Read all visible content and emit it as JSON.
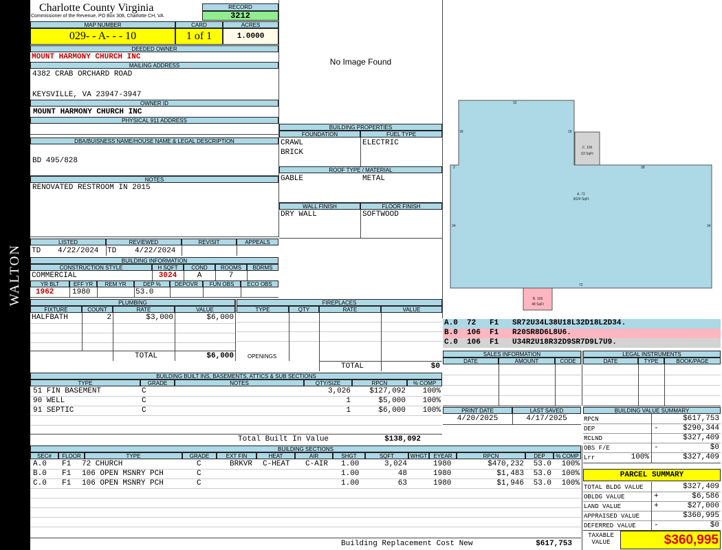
{
  "sidebar": {
    "owner_name": "WALTON"
  },
  "header": {
    "county": "Charlotte County Virginia",
    "commissioner": "Commissioner of the Revenue, PO Box 308, Charlotte CH, VA",
    "record_label": "RECORD",
    "record": "3212",
    "map_number_label": "MAP NUMBER",
    "map_number": "029- - A- - - 10",
    "card_label": "CARD",
    "card": "1 of 1",
    "acres_label": "ACRES",
    "acres": "1.0000"
  },
  "owner": {
    "deeded_owner_label": "DEEDED OWNER",
    "deeded_owner": "MOUNT HARMONY CHURCH INC",
    "mailing_label": "MAILING ADDRESS",
    "address_line1": "4382 CRAB ORCHARD ROAD",
    "address_line2": "KEYSVILLE, VA 23947-3947",
    "owner_id_label": "OWNER ID",
    "owner_id": "MOUNT HARMONY CHURCH INC",
    "physical_label": "PHYSICAL 911 ADDRESS",
    "physical": "",
    "dba_label": "DBA/BUISNESS NAME/HOUSE NAME & LEGAL DESCRIPTION",
    "dba": "BD 495/828",
    "notes_label": "NOTES",
    "notes": "RENOVATED RESTROOM IN 2015"
  },
  "image": {
    "placeholder": "No Image Found"
  },
  "building_properties": {
    "title": "BUILDING PROPERTIES",
    "foundation_label": "FOUNDATION",
    "foundation1": "CRAWL",
    "foundation2": "BRICK",
    "fuel_label": "FUEL TYPE",
    "fuel": "ELECTRIC",
    "roof_label": "ROOF TYPE / MATERIAL",
    "roof_type": "GABLE",
    "roof_material": "METAL",
    "wall_label": "WALL FINISH",
    "wall": "DRY WALL",
    "floor_label": "FLOOR FINISH",
    "floor": "SOFTWOOD"
  },
  "status": {
    "listed_label": "LISTED",
    "listed_by": "TD",
    "listed_date": "4/22/2024",
    "reviewed_label": "REVIEWED",
    "reviewed_by": "TD",
    "reviewed_date": "4/22/2024",
    "revisit_label": "REVISIT",
    "appeals_label": "APPEALS"
  },
  "building_info": {
    "title": "BUILDING INFORMATION",
    "style_label": "CONSTRUCTION STYLE",
    "style": "COMMERCIAL",
    "hsqft_label": "H SQFT",
    "hsqft": "3024",
    "cond_label": "COND",
    "cond": "A",
    "rooms_label": "ROOMS",
    "rooms": "7",
    "bdrms_label": "BDRMS",
    "bdrms": "",
    "yrblt_label": "YR BLT",
    "yrblt": "1962",
    "effyr_label": "EFF YR",
    "effyr": "1980",
    "remyr_label": "REM YR",
    "remyr": "",
    "dep_label": "DEP %",
    "dep": "53.0",
    "depovr_label": "DEPOVR",
    "funobs_label": "FUN OBS",
    "ecoobs_label": "ECO OBS"
  },
  "plumbing": {
    "title": "PLUMBING",
    "headers": [
      "FIXTURE",
      "COUNT",
      "RATE",
      "VALUE"
    ],
    "rows": [
      [
        "HALFBATH",
        "2",
        "$3,000",
        "$6,000"
      ]
    ],
    "total_label": "TOTAL",
    "total": "$6,000"
  },
  "fireplaces": {
    "title": "FIREPLACES",
    "headers": [
      "TYPE",
      "QTY",
      "RATE",
      "VALUE"
    ],
    "openings_label": "OPENINGS",
    "total_label": "TOTAL",
    "total": "$0"
  },
  "builtins": {
    "title": "BUILDING BUILT INS, BASEMENTS, ATTICS & SUB SECTIONS",
    "headers": [
      "TYPE",
      "GRADE",
      "NOTES",
      "QTY/SIZE",
      "RPCN",
      "% COMP"
    ],
    "rows": [
      [
        "51 FIN BASEMENT",
        "C",
        "",
        "3,026",
        "$127,092",
        "100%"
      ],
      [
        "90 WELL",
        "C",
        "",
        "1",
        "$5,000",
        "100%"
      ],
      [
        "91 SEPTIC",
        "C",
        "",
        "1",
        "$6,000",
        "100%"
      ]
    ],
    "total_label": "Total Built In Value",
    "total": "$138,092"
  },
  "sections": {
    "title": "BUILDING SECTIONS",
    "headers": [
      "SEC#",
      "FLOOR",
      "TYPE",
      "GRADE",
      "EXT FIN",
      "HEAT",
      "AIR",
      "SHGT",
      "SQFT",
      "WHGT",
      "EYEAR",
      "RPCN",
      "DEP",
      "% COMP"
    ],
    "rows": [
      [
        "A.0",
        "F1",
        "72 CHURCH",
        "C",
        "BRKVR",
        "C-HEAT",
        "C-AIR",
        "1.00",
        "3,024",
        "",
        "1980",
        "$470,232",
        "53.0",
        "100%"
      ],
      [
        "B.0",
        "F1",
        "106 OPEN MSNRY PCH",
        "C",
        "",
        "",
        "",
        "1.00",
        "48",
        "",
        "1980",
        "$1,483",
        "53.0",
        "100%"
      ],
      [
        "C.0",
        "F1",
        "106 OPEN MSNRY PCH",
        "C",
        "",
        "",
        "",
        "1.00",
        "63",
        "",
        "1980",
        "$1,946",
        "53.0",
        "100%"
      ]
    ],
    "total_label": "Building Replacement Cost New",
    "total": "$617,753"
  },
  "sketch": {
    "dims_a_top": "32",
    "dims_a_left_top": "18",
    "dims_a_inner": "18",
    "dims_step": "2",
    "dims_right_top": "38",
    "dims_left": "34",
    "dims_right": "34",
    "dims_bottom": "72",
    "label_a_name": "A. 72",
    "label_a_area": "3024 SqFt",
    "label_b_name": "B. 106",
    "label_b_area": "48 SqFt",
    "label_c_name": "C. 106",
    "label_c_area": "63 SqFt",
    "colors": {
      "a": "#add8e6",
      "b": "#ffb6c1",
      "c": "#d3d3d3"
    }
  },
  "legend": [
    {
      "text": "A.0  72   F1   SR72U34L38U18L32D18L2D34.",
      "color": "#add8e6"
    },
    {
      "text": "B.0  106  F1   R20SR8D6L8U6.",
      "color": "#ffb6c1"
    },
    {
      "text": "C.0  106  F1   U34R2U18R32D9SR7D9L7U9.",
      "color": "#d3d3d3"
    }
  ],
  "sales": {
    "title": "SALES INFORMATION",
    "headers": [
      "DATE",
      "AMOUNT",
      "CODE"
    ]
  },
  "legal": {
    "title": "LEGAL INSTRUMENTS",
    "headers": [
      "DATE",
      "TYPE",
      "BOOK/PAGE"
    ]
  },
  "dates": {
    "print_label": "PRINT DATE",
    "print": "4/20/2025",
    "saved_label": "LAST SAVED",
    "saved": "4/17/2025"
  },
  "value_summary": {
    "title": "BUILDING VALUE SUMMARY",
    "rows": [
      {
        "label": "RPCN",
        "sign": "",
        "value": "$617,753"
      },
      {
        "label": "DEP",
        "sign": "-",
        "value": "$290,344"
      },
      {
        "label": "RCLND",
        "sign": "",
        "value": "$327,409"
      },
      {
        "label": "OBS F/E",
        "sign": "-",
        "value": "$0"
      },
      {
        "label": "Lrr",
        "pct": "100%",
        "sign": "",
        "value": "$327,409"
      }
    ]
  },
  "parcel": {
    "title": "PARCEL SUMMARY",
    "rows": [
      {
        "label": "TOTAL BLDG VALUE",
        "sign": "",
        "value": "$327,409"
      },
      {
        "label": "OBLDG VALUE",
        "sign": "+",
        "value": "$6,586"
      },
      {
        "label": "LAND VALUE",
        "sign": "+",
        "value": "$27,000"
      },
      {
        "label": "APPRAISED VALUE",
        "sign": "",
        "value": "$360,995"
      },
      {
        "label": "DEFERRED VALUE",
        "sign": "-",
        "value": "$0"
      }
    ],
    "taxable_label1": "TAXABLE",
    "taxable_label2": "VALUE",
    "taxable": "$360,995"
  }
}
